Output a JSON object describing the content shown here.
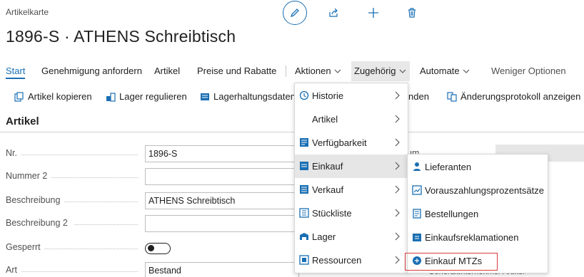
{
  "header": {
    "label": "Artikelkarte",
    "title": "1896-S · ATHENS Schreibtisch",
    "icons": [
      "pencil-icon",
      "share-icon",
      "plus-icon",
      "trash-icon"
    ]
  },
  "action_bar": {
    "items": [
      {
        "label": "Start",
        "active": true
      },
      {
        "label": "Genehmigung anfordern"
      },
      {
        "label": "Artikel"
      },
      {
        "label": "Preise und Rabatte"
      },
      {
        "label": "Aktionen"
      },
      {
        "label": "Zugehörig",
        "open": true
      },
      {
        "label": "Automate"
      },
      {
        "label": "Weniger Optionen"
      }
    ]
  },
  "promoted": {
    "items": [
      {
        "label": "Artikel kopieren",
        "icon": "copy-item-icon"
      },
      {
        "label": "Lager regulieren",
        "icon": "inventory-adjust-icon"
      },
      {
        "label": "Lagerhaltungsdaten e",
        "icon": "stock-data-icon"
      },
      {
        "label": "nden",
        "icon": ""
      },
      {
        "label": "Änderungsprotokoll anzeigen",
        "icon": "change-log-icon"
      }
    ]
  },
  "section": {
    "title": "Artikel"
  },
  "fields": [
    {
      "label": "Nr.",
      "value": "1896-S"
    },
    {
      "label": "Nummer 2",
      "value": ""
    },
    {
      "label": "Beschreibung",
      "value": "ATHENS Schreibtisch"
    },
    {
      "label": "Beschreibung 2",
      "value": ""
    },
    {
      "label": "Gesperrt",
      "value": ""
    },
    {
      "label": "Art",
      "value": "Bestand"
    }
  ],
  "right_col": {
    "partial_label_1": "um",
    "partial_label_2": "Generalunternehmer Artikel"
  },
  "related_menu": {
    "items": [
      {
        "label": "Historie",
        "icon": "history-icon"
      },
      {
        "label": "Artikel",
        "icon": ""
      },
      {
        "label": "Verfügbarkeit",
        "icon": "availability-icon"
      },
      {
        "label": "Einkauf",
        "icon": "purchase-icon",
        "highlighted": true
      },
      {
        "label": "Verkauf",
        "icon": "sales-icon"
      },
      {
        "label": "Stückliste",
        "icon": "bom-icon"
      },
      {
        "label": "Lager",
        "icon": "warehouse-icon"
      },
      {
        "label": "Ressourcen",
        "icon": "resources-icon"
      }
    ]
  },
  "purchase_submenu": {
    "items": [
      {
        "label": "Lieferanten",
        "icon": "vendor-icon"
      },
      {
        "label": "Vorauszahlungsprozentsätze",
        "icon": "prepayment-icon"
      },
      {
        "label": "Bestellungen",
        "icon": "order-icon"
      },
      {
        "label": "Einkaufsreklamationen",
        "icon": "return-icon"
      },
      {
        "label": "Einkauf MTZs",
        "icon": "purchase-mtz-icon",
        "outlined": true
      }
    ]
  },
  "colors": {
    "accent": "#1a6fb3",
    "highlight_outline": "#d63c3c"
  }
}
